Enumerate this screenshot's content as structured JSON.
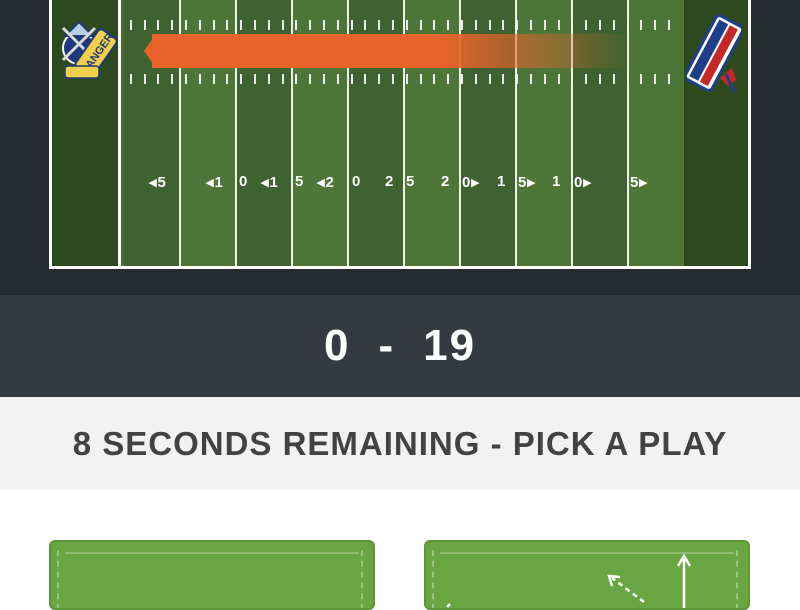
{
  "score": {
    "home": "0",
    "separator": "-",
    "away": "19"
  },
  "timer": {
    "text": "8 SECONDS REMAINING - PICK A PLAY"
  },
  "field": {
    "yard_numbers": [
      "◂5",
      "◂1",
      "0",
      "◂1",
      "5",
      "◂2",
      "0",
      "2",
      "5",
      "2",
      "0▸",
      "1",
      "5▸",
      "1",
      "0▸",
      "5▸"
    ],
    "drive_direction": "left",
    "drive_color": "#e8622a"
  },
  "teams": {
    "left_logo_icon": "navy-gold-team-logo-icon",
    "right_logo_icon": "red-white-blue-team-logo-icon"
  },
  "plays": [
    {
      "name_icon": "blank-play-diagram-icon"
    },
    {
      "name_icon": "pass-route-play-diagram-icon"
    }
  ],
  "colors": {
    "field_green": "#4c6e35",
    "endzone_green": "#2c4a1e",
    "score_bar": "#343a3f",
    "play_card": "#69a541"
  }
}
